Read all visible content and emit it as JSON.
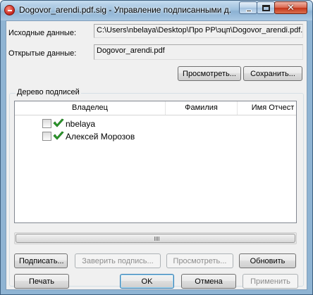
{
  "window": {
    "title": "Dogovor_arendi.pdf.sig - Управление подписанными д..."
  },
  "fields": {
    "source_label": "Исходные данные:",
    "source_value": "C:\\Users\\nbelaya\\Desktop\\Про РР\\эцп\\Dogovor_arendi.pdf.",
    "open_label": "Открытые данные:",
    "open_value": "Dogovor_arendi.pdf"
  },
  "file_buttons": {
    "view": "Просмотреть...",
    "save": "Сохранить..."
  },
  "signature_tree": {
    "group_label": "Дерево подписей",
    "columns": [
      "Владелец",
      "Фамилия",
      "Имя Отчест"
    ],
    "rows": [
      {
        "label": "nbelaya",
        "checked": false
      },
      {
        "label": "Алексей Морозов",
        "checked": false
      }
    ]
  },
  "tree_buttons": {
    "sign": "Подписать...",
    "certify": "Заверить подпись...",
    "view": "Просмотреть...",
    "refresh": "Обновить"
  },
  "dialog_buttons": {
    "print": "Печать",
    "ok": "OK",
    "cancel": "Отмена",
    "apply": "Применить"
  },
  "colors": {
    "accent": "#8fb4d3",
    "check_green": "#2fa32f"
  },
  "icons": {
    "app": "signature-app-icon",
    "status": "green-check-icon"
  }
}
